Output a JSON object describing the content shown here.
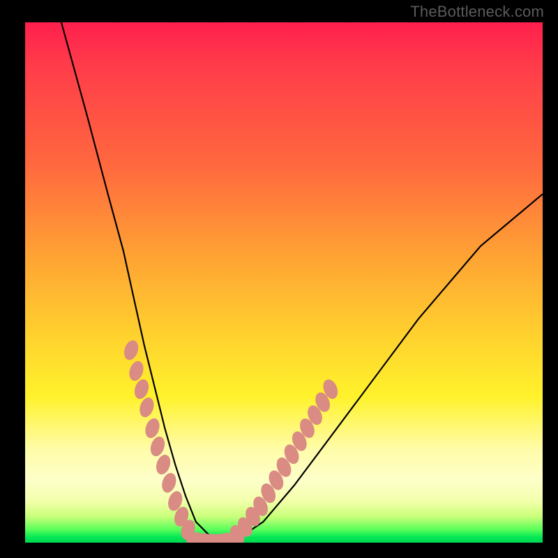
{
  "watermark": "TheBottleneck.com",
  "chart_data": {
    "type": "line",
    "title": "",
    "xlabel": "",
    "ylabel": "",
    "xlim": [
      0,
      100
    ],
    "ylim": [
      0,
      100
    ],
    "grid": false,
    "legend": false,
    "series": [
      {
        "name": "bottleneck-curve",
        "x": [
          7,
          12,
          16,
          19,
          21,
          23,
          25,
          27,
          29,
          31,
          33,
          36,
          40,
          46,
          52,
          58,
          64,
          70,
          76,
          82,
          88,
          94,
          100
        ],
        "values": [
          100,
          82,
          67,
          56,
          47,
          38,
          30,
          22,
          15,
          9,
          4,
          1,
          0,
          4,
          11,
          19,
          27,
          35,
          43,
          50,
          57,
          62,
          67
        ]
      }
    ],
    "annotations": {
      "minimum_x": 33,
      "beads_left": [
        [
          20.5,
          37
        ],
        [
          21.5,
          33
        ],
        [
          22.5,
          29.5
        ],
        [
          23.5,
          26
        ],
        [
          24.6,
          22
        ],
        [
          25.6,
          18.5
        ],
        [
          26.7,
          15
        ],
        [
          27.8,
          11.5
        ],
        [
          29.0,
          8
        ],
        [
          30.2,
          5
        ],
        [
          31.5,
          2.5
        ]
      ],
      "beads_floor": [
        [
          33,
          0.7
        ],
        [
          34.5,
          0.5
        ],
        [
          36,
          0.4
        ],
        [
          37.5,
          0.4
        ],
        [
          39,
          0.6
        ]
      ],
      "beads_right": [
        [
          41,
          1.5
        ],
        [
          42.5,
          3
        ],
        [
          44,
          5
        ],
        [
          45.5,
          7
        ],
        [
          47,
          9.5
        ],
        [
          48.5,
          12
        ],
        [
          50,
          14.5
        ],
        [
          51.5,
          17
        ],
        [
          53,
          19.5
        ],
        [
          54.5,
          22
        ],
        [
          56,
          24.5
        ],
        [
          57.5,
          27
        ],
        [
          59,
          29.5
        ]
      ]
    },
    "gradient_stops": [
      {
        "pos": 0,
        "color": "#ff1f4d"
      },
      {
        "pos": 28,
        "color": "#ff6a3e"
      },
      {
        "pos": 60,
        "color": "#ffd12e"
      },
      {
        "pos": 88,
        "color": "#fdffc9"
      },
      {
        "pos": 99,
        "color": "#00e756"
      }
    ]
  }
}
